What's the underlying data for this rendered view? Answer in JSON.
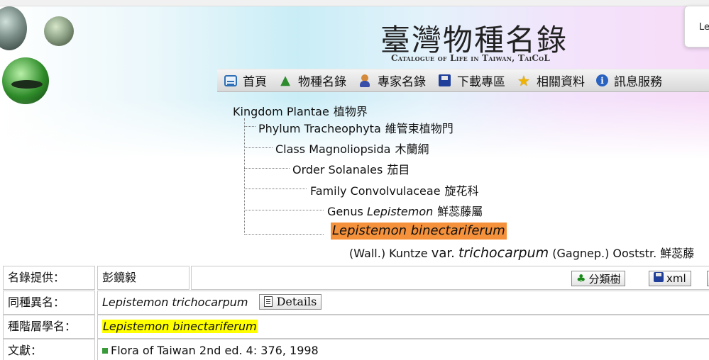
{
  "header": {
    "title": "臺灣物種名錄",
    "subtitle": "Catalogue of Life in Taiwan, TaiCoL",
    "popup_text": "Le"
  },
  "nav": {
    "items": [
      {
        "label": "首頁",
        "icon": "home-icon"
      },
      {
        "label": "物種名錄",
        "icon": "tree-icon"
      },
      {
        "label": "專家名錄",
        "icon": "person-icon"
      },
      {
        "label": "下載專區",
        "icon": "floppy-icon"
      },
      {
        "label": "相關資料",
        "icon": "star-icon"
      },
      {
        "label": "訊息服務",
        "icon": "info-icon"
      }
    ]
  },
  "taxonomy": {
    "kingdom": {
      "rank": "Kingdom",
      "name": "Plantae",
      "zh": "植物界"
    },
    "phylum": {
      "rank": "Phylum",
      "name": "Tracheophyta",
      "zh": "維管束植物門"
    },
    "class": {
      "rank": "Class",
      "name": "Magnoliopsida",
      "zh": "木蘭綱"
    },
    "order": {
      "rank": "Order",
      "name": "Solanales",
      "zh": "茄目"
    },
    "family": {
      "rank": "Family",
      "name": "Convolvulaceae",
      "zh": "旋花科"
    },
    "genus": {
      "rank": "Genus",
      "name": "Lepistemon",
      "zh": "鮮蕊藤屬"
    },
    "species": "Lepistemon binectariferum",
    "author": "(Wall.) Kuntze",
    "var_label": "var.",
    "var_epithet": "trichocarpum",
    "var_author": "(Gagnep.) Ooststr.",
    "var_zh": "鮮蕊藤"
  },
  "table": {
    "provider": {
      "label": "名錄提供：",
      "value": "彭鏡毅"
    },
    "buttons": {
      "tree": "分類樹",
      "xml": "xml"
    },
    "synonym": {
      "label": "同種異名：",
      "value": "Lepistemon trichocarpum",
      "details": "Details"
    },
    "infraspecific": {
      "label": "種階層學名：",
      "value": "Lepistemon binectariferum"
    },
    "literature": {
      "label": "文獻：",
      "value": "Flora of Taiwan 2nd ed. 4: 376, 1998"
    }
  },
  "colors": {
    "species_highlight": "#f5913a",
    "name_highlight": "#ffff00",
    "nav_bg": "#dcdcdc"
  }
}
